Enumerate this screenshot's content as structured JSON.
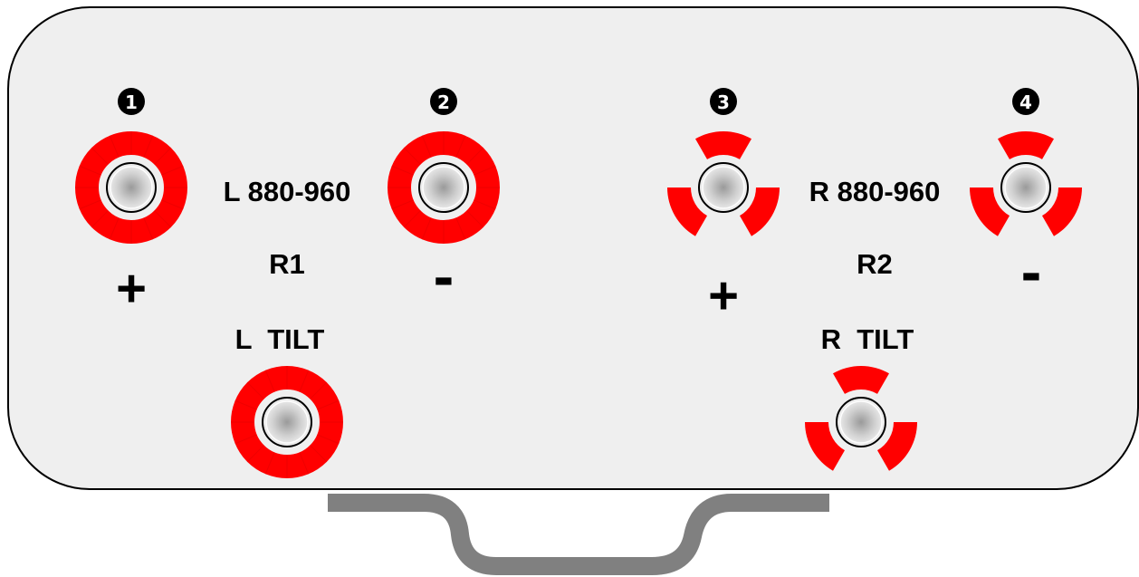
{
  "colors": {
    "panel_fill": "#efefef",
    "panel_stroke": "#000000",
    "accent_red": "#ff0000",
    "bracket": "#808080",
    "label_text": "#000000"
  },
  "terminals": [
    {
      "name": "terminal-1",
      "number": "1",
      "style": "ring",
      "polarity": "+"
    },
    {
      "name": "terminal-2",
      "number": "2",
      "style": "ring",
      "polarity": "-"
    },
    {
      "name": "terminal-3",
      "number": "3",
      "style": "trefoil",
      "polarity": "+"
    },
    {
      "name": "terminal-4",
      "number": "4",
      "style": "trefoil",
      "polarity": "-"
    },
    {
      "name": "terminal-l-tilt",
      "style": "ring"
    },
    {
      "name": "terminal-r-tilt",
      "style": "trefoil"
    }
  ],
  "labels": {
    "left_range": "L 880-960",
    "left_id": "R1",
    "left_tilt": "L  TILT",
    "right_range": "R 880-960",
    "right_id": "R2",
    "right_tilt": "R  TILT",
    "plus_left": "+",
    "minus_left": "-",
    "plus_right": "+",
    "minus_right": "-"
  }
}
